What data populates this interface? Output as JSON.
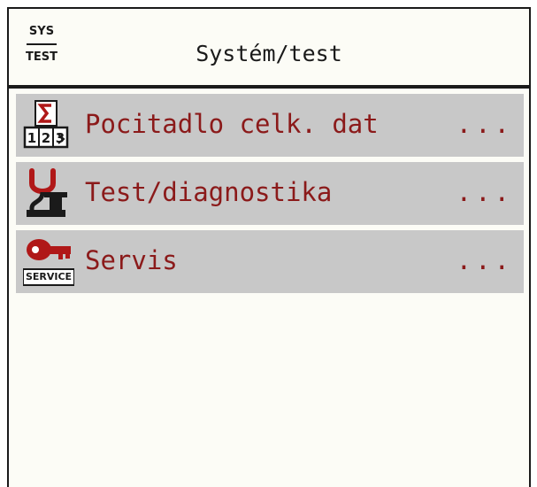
{
  "header": {
    "sys_top": "SYS",
    "sys_bottom": "TEST",
    "title": "Systém/test"
  },
  "menu": {
    "items": [
      {
        "label": "Pocitadlo celk. dat",
        "more": "...",
        "icon": "sigma-counter-icon"
      },
      {
        "label": "Test/diagnostika",
        "more": "...",
        "icon": "stethoscope-icon"
      },
      {
        "label": "Servis",
        "more": "...",
        "icon": "service-key-icon",
        "icon_text": "SERVICE"
      }
    ]
  },
  "colors": {
    "label": "#8b1a1a",
    "icon_red": "#b01818",
    "item_bg": "#c8c8c8",
    "screen_bg": "#fcfcf6"
  }
}
